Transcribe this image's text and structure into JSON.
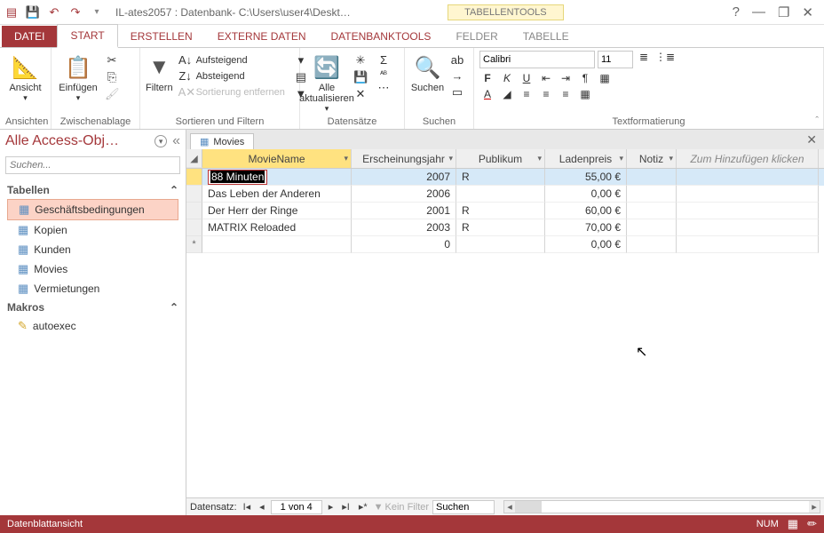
{
  "title": "IL-ates2057 : Datenbank- C:\\Users\\user4\\Deskt…",
  "contextTool": "TABELLENTOOLS",
  "tabs": {
    "file": "DATEI",
    "start": "START",
    "erstellen": "ERSTELLEN",
    "externe": "EXTERNE DATEN",
    "dbtools": "DATENBANKTOOLS",
    "felder": "FELDER",
    "tabelle": "TABELLE"
  },
  "ribbon": {
    "ansicht": "Ansicht",
    "ansichten": "Ansichten",
    "einfuegen": "Einfügen",
    "zwischen": "Zwischenablage",
    "filtern": "Filtern",
    "aufst": "Aufsteigend",
    "abst": "Absteigend",
    "sortent": "Sortierung entfernen",
    "sortfilt": "Sortieren und Filtern",
    "alleakt": "Alle aktualisieren",
    "datens": "Datensätze",
    "suchen": "Suchen",
    "suchenGrp": "Suchen",
    "font": "Calibri",
    "size": "11",
    "textfmt": "Textformatierung"
  },
  "nav": {
    "title": "Alle Access-Obj…",
    "searchPH": "Suchen...",
    "tabellen": "Tabellen",
    "makros": "Makros",
    "items": [
      "Geschäftsbedingungen",
      "Kopien",
      "Kunden",
      "Movies",
      "Vermietungen"
    ],
    "macroItems": [
      "autoexec"
    ]
  },
  "doc": {
    "tab": "Movies"
  },
  "columns": {
    "name": "MovieName",
    "year": "Erscheinungsjahr",
    "pub": "Publikum",
    "price": "Ladenpreis",
    "note": "Notiz",
    "add": "Zum Hinzufügen klicken"
  },
  "rows": [
    {
      "name_sel": "88 Minuten",
      "year": "2007",
      "pub": "R",
      "price": "55,00 €"
    },
    {
      "name": "Das Leben der Anderen",
      "year": "2006",
      "pub": "",
      "price": "0,00 €"
    },
    {
      "name": "Der Herr der Ringe",
      "year": "2001",
      "pub": "R",
      "price": "60,00 €"
    },
    {
      "name": "MATRIX Reloaded",
      "year": "2003",
      "pub": "R",
      "price": "70,00 €"
    }
  ],
  "newrow": {
    "year": "0",
    "price": "0,00 €"
  },
  "recnav": {
    "label": "Datensatz:",
    "pos": "1 von 4",
    "nofilter": "Kein Filter",
    "search": "Suchen"
  },
  "status": {
    "view": "Datenblattansicht",
    "num": "NUM"
  }
}
